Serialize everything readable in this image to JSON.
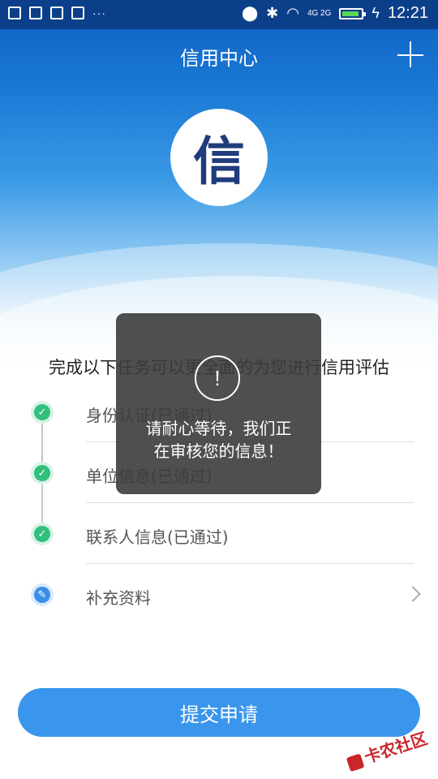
{
  "status_bar": {
    "time": "12:21",
    "icons": [
      "image-icon",
      "apps-icon",
      "message-icon",
      "apps-icon",
      "more-dots-icon",
      "location-icon",
      "bluetooth-icon",
      "wifi-icon",
      "signal-icon",
      "battery-icon",
      "charging-icon"
    ],
    "network": "4G 2G"
  },
  "header": {
    "title": "信用中心",
    "add_icon": "plus-icon"
  },
  "logo": {
    "text": "信"
  },
  "intro": "完成以下任务可以更全面的为您进行信用评估",
  "tasks": [
    {
      "label": "身份认证(已通过)",
      "status": "done",
      "icon": "check-icon"
    },
    {
      "label": "单位信息(已通过)",
      "status": "done",
      "icon": "check-icon"
    },
    {
      "label": "联系人信息(已通过)",
      "status": "done",
      "icon": "check-icon"
    },
    {
      "label": "补充资料",
      "status": "pending",
      "icon": "edit-icon"
    }
  ],
  "submit_label": "提交申请",
  "toast": {
    "icon": "exclamation-icon",
    "message_line1": "请耐心等待，我们正",
    "message_line2": "在审核您的信息！"
  },
  "watermark": "卡农社区",
  "colors": {
    "primary": "#3a96ec",
    "success": "#30c07c",
    "status_bar": "#0b3f8a"
  }
}
